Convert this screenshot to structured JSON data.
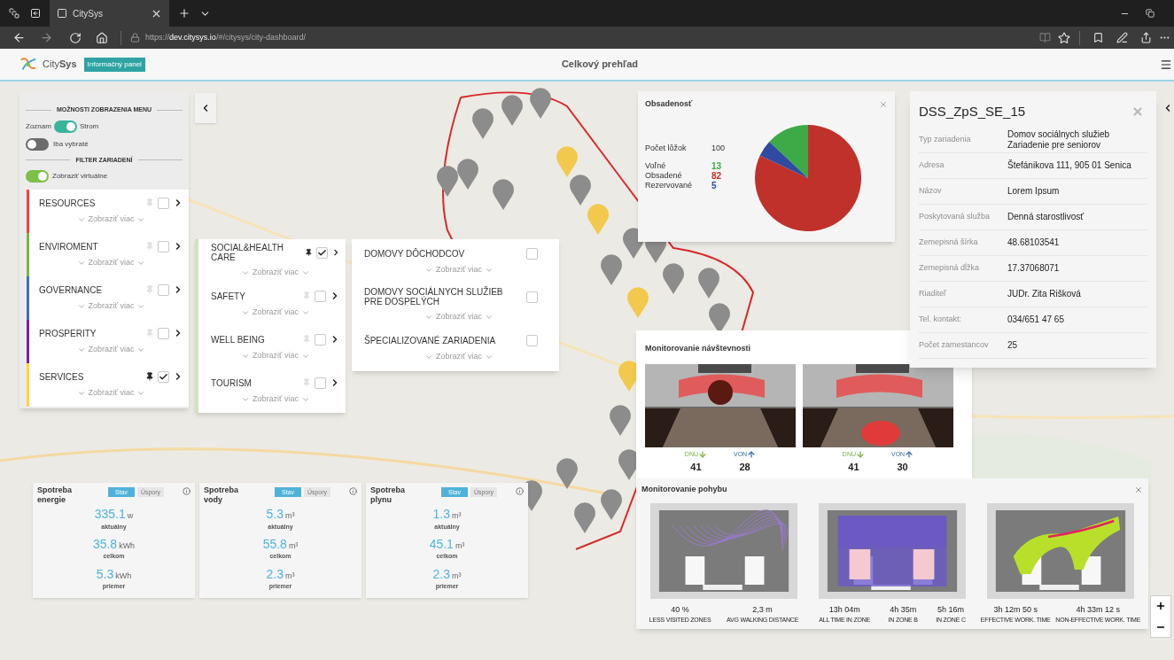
{
  "browser": {
    "tab_title": "CitySys",
    "url_scheme": "https://",
    "url_host": "dev.citysys.io",
    "url_path": "/#/citysys/city-dashboard/"
  },
  "app": {
    "logo": "City**Sys**",
    "badge": "Informačný panel",
    "title": "Celkový prehľad"
  },
  "menu": {
    "heading": "MOŽNOSTI ZOBRAZENIA MENU",
    "list_label": "Zoznam",
    "tree_label": "Strom",
    "tree_mode": true,
    "only_selected": {
      "label": "Iba vybraté",
      "on": false
    },
    "filter_heading": "FILTER ZARIADENÍ",
    "virtual": {
      "label": "Zobraziť virtuálne",
      "on": true
    }
  },
  "categories": [
    {
      "name": "RESOURCES",
      "color": "#f44336",
      "pinned": false,
      "checked": false,
      "more": "Zobraziť viac"
    },
    {
      "name": "ENVIROMENT",
      "color": "#7cb342",
      "pinned": false,
      "checked": false,
      "more": "Zobraziť viac"
    },
    {
      "name": "GOVERNANCE",
      "color": "#3f6fb5",
      "pinned": false,
      "checked": false,
      "more": "Zobraziť viac"
    },
    {
      "name": "PROSPERITY",
      "color": "#7b1fa2",
      "pinned": false,
      "checked": false,
      "more": "Zobraziť viac"
    },
    {
      "name": "SERVICES",
      "color": "#fdd835",
      "pinned": true,
      "checked": true,
      "more": "Zobraziť viac"
    }
  ],
  "subcategories": [
    {
      "name": "SOCIAL&HEALTH CARE",
      "pinned": true,
      "checked": true,
      "more": "Zobraziť viac"
    },
    {
      "name": "SAFETY",
      "pinned": false,
      "checked": false,
      "more": "Zobraziť viac"
    },
    {
      "name": "WELL BEING",
      "pinned": false,
      "checked": false,
      "more": "Zobraziť viac"
    },
    {
      "name": "TOURISM",
      "pinned": false,
      "checked": false,
      "more": "Zobraziť viac"
    }
  ],
  "facility_types": [
    {
      "name": "DOMOVY DÔCHODCOV",
      "checked": false,
      "more": "Zobraziť viac"
    },
    {
      "name": "DOMOVY SOCIÁLNYCH SLUŽIEB PRE DOSPELÝCH",
      "checked": false,
      "more": "Zobraziť viac"
    },
    {
      "name": "ŠPECIALIZOVANÉ ZARIADENIA",
      "checked": false,
      "more": "Zobraziť viac"
    }
  ],
  "occupancy": {
    "title": "Obsadenosť",
    "beds_label": "Počet lôžok",
    "beds_total": "100",
    "items": [
      {
        "value": "13",
        "color": "#3daa47"
      },
      {
        "value": "82",
        "color": "#c0312b"
      },
      {
        "value": "5",
        "color": "#2f4aa0"
      }
    ],
    "chart_data": {
      "type": "pie",
      "categories": [
        "Voľné",
        "Obsadené",
        "Rezervované"
      ],
      "values": [
        13,
        82,
        5
      ]
    }
  },
  "facility": {
    "title": "DSS_ZpS_SE_15",
    "fields": [
      {
        "label": "Typ zariadenia",
        "values": [
          "Domov sociálnych služieb",
          "Zariadenie pre seniorov"
        ]
      },
      {
        "label": "Adresa",
        "values": [
          "Štefánikova 111, 905 01 Senica"
        ]
      },
      {
        "label": "Názov",
        "values": [
          "Lorem Ipsum"
        ]
      },
      {
        "label": "Poskytovaná služba",
        "values": [
          "Denná starostlivosť"
        ]
      },
      {
        "label": "Zemepisná šírka",
        "values": [
          "48.68103541"
        ]
      },
      {
        "label": "Zemepisná dĺžka",
        "values": [
          "17.37068071"
        ]
      },
      {
        "label": "Riaditeľ",
        "values": [
          "JUDr. Zita Rišková"
        ]
      },
      {
        "label": "Tel. kontakt:",
        "values": [
          "034/651 47 65"
        ]
      },
      {
        "label": "Počet zamestancov",
        "values": [
          "25"
        ]
      }
    ]
  },
  "visits": {
    "title": "Monitorovanie návštevnosti",
    "cameras": [
      {
        "in_label": "DNU",
        "in_count": "41",
        "out_label": "VON",
        "out_count": "28"
      },
      {
        "in_label": "DNU",
        "in_count": "41",
        "out_label": "VON",
        "out_count": "30"
      }
    ]
  },
  "movement": {
    "title": "Monitorovanie pohybu",
    "plans": [
      {
        "kind": "trails",
        "stats": [
          {
            "value": "40 %",
            "label": "LESS VISITED ZONES"
          },
          {
            "value": "2,3 m",
            "label": "AVG WALKING DISTANCE"
          }
        ]
      },
      {
        "kind": "zones",
        "stats": [
          {
            "value": "13h 04m",
            "label": "ALL TIME IN ZONE"
          },
          {
            "value": "4h 35m",
            "label": "IN ZONE B"
          },
          {
            "value": "5h 16m",
            "label": "IN ZONE C"
          }
        ]
      },
      {
        "kind": "heat",
        "stats": [
          {
            "value": "3h 12m 50 s",
            "label": "EFFECTIVE WORK. TIME"
          },
          {
            "value": "4h 33m 12 s",
            "label": "NON-EFFECTIVE WORK. TIME"
          }
        ]
      }
    ]
  },
  "consumption": [
    {
      "title": "Spotreba energie",
      "tabs": [
        {
          "label": "Stav",
          "selected": true
        },
        {
          "label": "Úspory",
          "selected": false
        }
      ],
      "readings": [
        {
          "value": "335.1",
          "unit": "w",
          "label": "aktuálny"
        },
        {
          "value": "35.8",
          "unit": "kWh",
          "label": "celkom"
        },
        {
          "value": "5.3",
          "unit": "kWh",
          "label": "priemer"
        }
      ]
    },
    {
      "title": "Spotreba vody",
      "tabs": [
        {
          "label": "Stav",
          "selected": true
        },
        {
          "label": "Úspory",
          "selected": false
        }
      ],
      "readings": [
        {
          "value": "5.3",
          "unit": "m³",
          "label": "aktuálny"
        },
        {
          "value": "55.8",
          "unit": "m³",
          "label": "celkom"
        },
        {
          "value": "2.3",
          "unit": "m³",
          "label": "priemer"
        }
      ]
    },
    {
      "title": "Spotreba plynu",
      "tabs": [
        {
          "label": "Stav",
          "selected": true
        },
        {
          "label": "Úspory",
          "selected": false
        }
      ],
      "readings": [
        {
          "value": "1.3",
          "unit": "m³",
          "label": "aktuálny"
        },
        {
          "value": "45.1",
          "unit": "m³",
          "label": "celkom"
        },
        {
          "value": "2.3",
          "unit": "m³",
          "label": "priemer"
        }
      ]
    }
  ]
}
